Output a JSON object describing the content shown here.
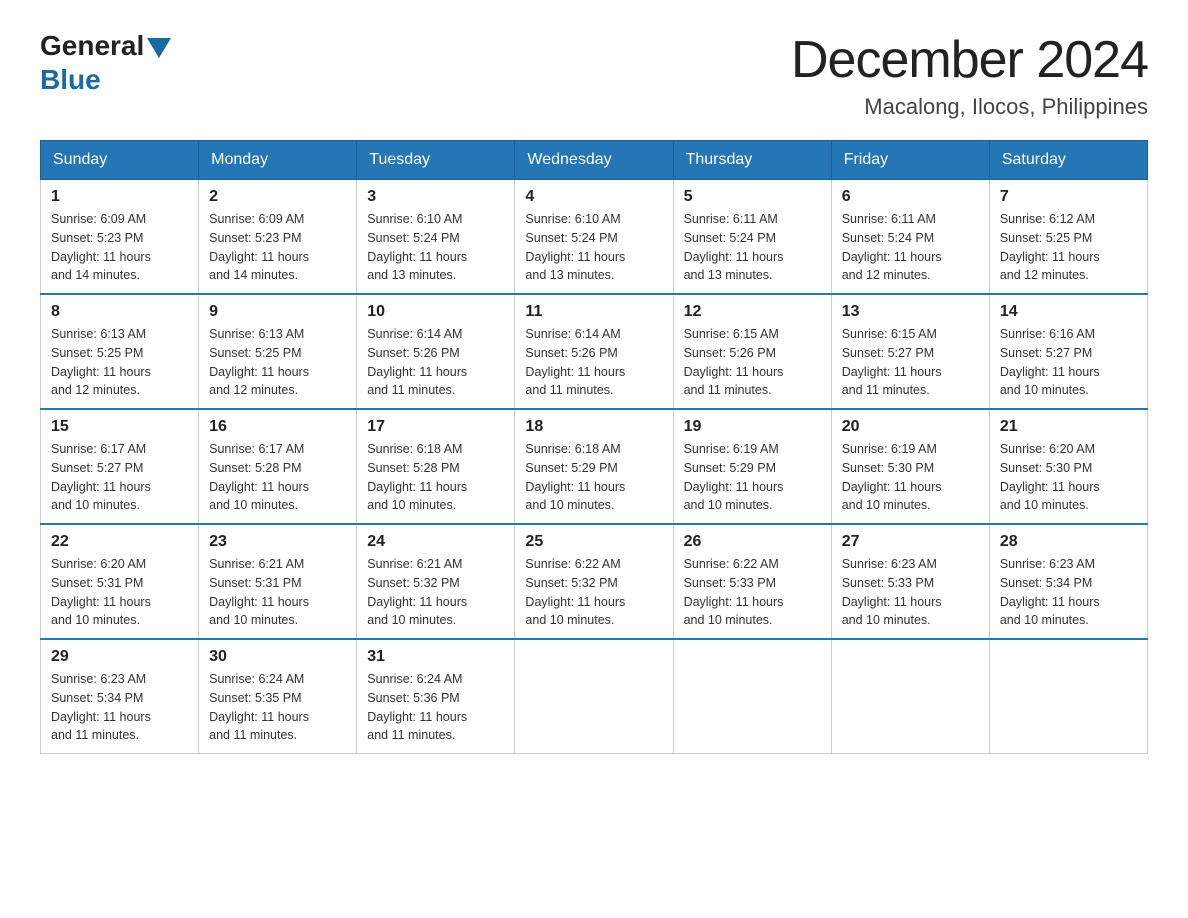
{
  "logo": {
    "general": "General",
    "blue": "Blue"
  },
  "title": "December 2024",
  "subtitle": "Macalong, Ilocos, Philippines",
  "days_of_week": [
    "Sunday",
    "Monday",
    "Tuesday",
    "Wednesday",
    "Thursday",
    "Friday",
    "Saturday"
  ],
  "weeks": [
    [
      {
        "day": "1",
        "sunrise": "6:09 AM",
        "sunset": "5:23 PM",
        "daylight": "11 hours and 14 minutes."
      },
      {
        "day": "2",
        "sunrise": "6:09 AM",
        "sunset": "5:23 PM",
        "daylight": "11 hours and 14 minutes."
      },
      {
        "day": "3",
        "sunrise": "6:10 AM",
        "sunset": "5:24 PM",
        "daylight": "11 hours and 13 minutes."
      },
      {
        "day": "4",
        "sunrise": "6:10 AM",
        "sunset": "5:24 PM",
        "daylight": "11 hours and 13 minutes."
      },
      {
        "day": "5",
        "sunrise": "6:11 AM",
        "sunset": "5:24 PM",
        "daylight": "11 hours and 13 minutes."
      },
      {
        "day": "6",
        "sunrise": "6:11 AM",
        "sunset": "5:24 PM",
        "daylight": "11 hours and 12 minutes."
      },
      {
        "day": "7",
        "sunrise": "6:12 AM",
        "sunset": "5:25 PM",
        "daylight": "11 hours and 12 minutes."
      }
    ],
    [
      {
        "day": "8",
        "sunrise": "6:13 AM",
        "sunset": "5:25 PM",
        "daylight": "11 hours and 12 minutes."
      },
      {
        "day": "9",
        "sunrise": "6:13 AM",
        "sunset": "5:25 PM",
        "daylight": "11 hours and 12 minutes."
      },
      {
        "day": "10",
        "sunrise": "6:14 AM",
        "sunset": "5:26 PM",
        "daylight": "11 hours and 11 minutes."
      },
      {
        "day": "11",
        "sunrise": "6:14 AM",
        "sunset": "5:26 PM",
        "daylight": "11 hours and 11 minutes."
      },
      {
        "day": "12",
        "sunrise": "6:15 AM",
        "sunset": "5:26 PM",
        "daylight": "11 hours and 11 minutes."
      },
      {
        "day": "13",
        "sunrise": "6:15 AM",
        "sunset": "5:27 PM",
        "daylight": "11 hours and 11 minutes."
      },
      {
        "day": "14",
        "sunrise": "6:16 AM",
        "sunset": "5:27 PM",
        "daylight": "11 hours and 10 minutes."
      }
    ],
    [
      {
        "day": "15",
        "sunrise": "6:17 AM",
        "sunset": "5:27 PM",
        "daylight": "11 hours and 10 minutes."
      },
      {
        "day": "16",
        "sunrise": "6:17 AM",
        "sunset": "5:28 PM",
        "daylight": "11 hours and 10 minutes."
      },
      {
        "day": "17",
        "sunrise": "6:18 AM",
        "sunset": "5:28 PM",
        "daylight": "11 hours and 10 minutes."
      },
      {
        "day": "18",
        "sunrise": "6:18 AM",
        "sunset": "5:29 PM",
        "daylight": "11 hours and 10 minutes."
      },
      {
        "day": "19",
        "sunrise": "6:19 AM",
        "sunset": "5:29 PM",
        "daylight": "11 hours and 10 minutes."
      },
      {
        "day": "20",
        "sunrise": "6:19 AM",
        "sunset": "5:30 PM",
        "daylight": "11 hours and 10 minutes."
      },
      {
        "day": "21",
        "sunrise": "6:20 AM",
        "sunset": "5:30 PM",
        "daylight": "11 hours and 10 minutes."
      }
    ],
    [
      {
        "day": "22",
        "sunrise": "6:20 AM",
        "sunset": "5:31 PM",
        "daylight": "11 hours and 10 minutes."
      },
      {
        "day": "23",
        "sunrise": "6:21 AM",
        "sunset": "5:31 PM",
        "daylight": "11 hours and 10 minutes."
      },
      {
        "day": "24",
        "sunrise": "6:21 AM",
        "sunset": "5:32 PM",
        "daylight": "11 hours and 10 minutes."
      },
      {
        "day": "25",
        "sunrise": "6:22 AM",
        "sunset": "5:32 PM",
        "daylight": "11 hours and 10 minutes."
      },
      {
        "day": "26",
        "sunrise": "6:22 AM",
        "sunset": "5:33 PM",
        "daylight": "11 hours and 10 minutes."
      },
      {
        "day": "27",
        "sunrise": "6:23 AM",
        "sunset": "5:33 PM",
        "daylight": "11 hours and 10 minutes."
      },
      {
        "day": "28",
        "sunrise": "6:23 AM",
        "sunset": "5:34 PM",
        "daylight": "11 hours and 10 minutes."
      }
    ],
    [
      {
        "day": "29",
        "sunrise": "6:23 AM",
        "sunset": "5:34 PM",
        "daylight": "11 hours and 11 minutes."
      },
      {
        "day": "30",
        "sunrise": "6:24 AM",
        "sunset": "5:35 PM",
        "daylight": "11 hours and 11 minutes."
      },
      {
        "day": "31",
        "sunrise": "6:24 AM",
        "sunset": "5:36 PM",
        "daylight": "11 hours and 11 minutes."
      },
      null,
      null,
      null,
      null
    ]
  ],
  "labels": {
    "sunrise": "Sunrise:",
    "sunset": "Sunset:",
    "daylight": "Daylight:"
  }
}
